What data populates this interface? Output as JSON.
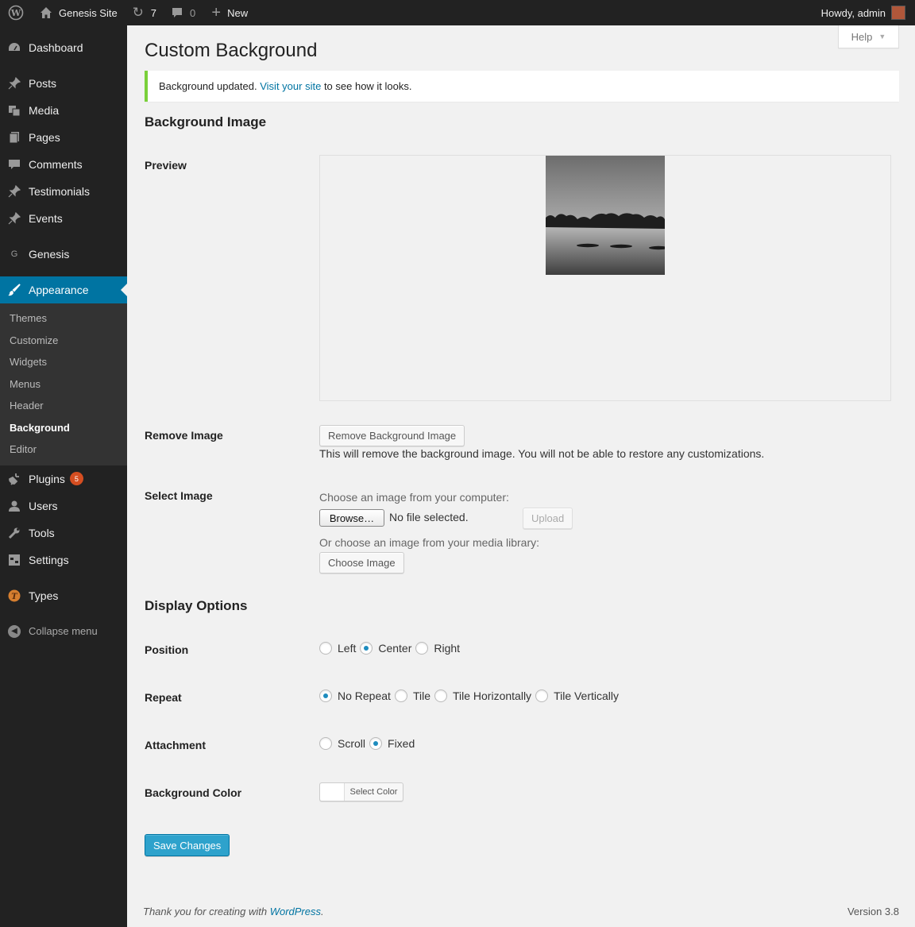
{
  "adminbar": {
    "site_name": "Genesis Site",
    "updates_count": "7",
    "comments_count": "0",
    "new_label": "New",
    "howdy": "Howdy, admin"
  },
  "sidebar": {
    "dashboard": "Dashboard",
    "posts": "Posts",
    "media": "Media",
    "pages": "Pages",
    "comments": "Comments",
    "testimonials": "Testimonials",
    "events": "Events",
    "genesis": "Genesis",
    "genesis_icon": "G",
    "appearance": "Appearance",
    "submenu": [
      "Themes",
      "Customize",
      "Widgets",
      "Menus",
      "Header",
      "Background",
      "Editor"
    ],
    "plugins": "Plugins",
    "plugins_badge": "5",
    "users": "Users",
    "tools": "Tools",
    "settings": "Settings",
    "types": "Types",
    "collapse": "Collapse menu"
  },
  "page": {
    "help": "Help",
    "title": "Custom Background",
    "notice_before": "Background updated.",
    "notice_link": "Visit your site",
    "notice_after": "to see how it looks."
  },
  "bg_image": {
    "heading": "Background Image",
    "preview_label": "Preview",
    "remove_label": "Remove Image",
    "remove_button": "Remove Background Image",
    "remove_desc": "This will remove the background image. You will not be able to restore any customizations.",
    "select_label": "Select Image",
    "choose_computer": "Choose an image from your computer:",
    "browse_button": "Browse…",
    "no_file": "No file selected.",
    "upload_button": "Upload",
    "choose_library": "Or choose an image from your media library:",
    "choose_button": "Choose Image"
  },
  "display": {
    "heading": "Display Options",
    "position_label": "Position",
    "position_options": [
      "Left",
      "Center",
      "Right"
    ],
    "position_selected": "Center",
    "repeat_label": "Repeat",
    "repeat_options": [
      "No Repeat",
      "Tile",
      "Tile Horizontally",
      "Tile Vertically"
    ],
    "repeat_selected": "No Repeat",
    "attachment_label": "Attachment",
    "attachment_options": [
      "Scroll",
      "Fixed"
    ],
    "attachment_selected": "Fixed",
    "color_label": "Background Color",
    "color_button": "Select Color",
    "save_button": "Save Changes"
  },
  "footer": {
    "thanks_before": "Thank you for creating with",
    "thanks_link": "WordPress",
    "thanks_after": ".",
    "version": "Version 3.8"
  },
  "colors": {
    "accent": "#0074a2",
    "primary_button": "#2ea2cc",
    "notice_border": "#7ad03a",
    "badge": "#d54e21"
  }
}
